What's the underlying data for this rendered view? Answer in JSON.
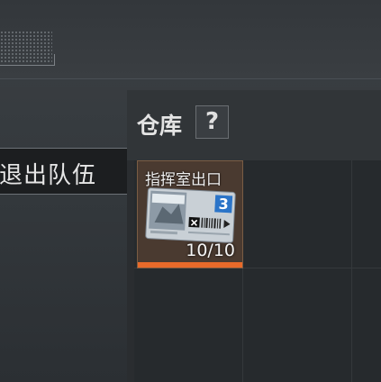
{
  "leave_team": {
    "label": "退出队伍"
  },
  "warehouse": {
    "title": "仓库",
    "help_label": "?"
  },
  "item": {
    "name": "指挥室出口",
    "badge": "3",
    "count": "10/10"
  },
  "colors": {
    "rarity_bar": "#e86a2a",
    "slot_bg": "#4a3a30"
  }
}
